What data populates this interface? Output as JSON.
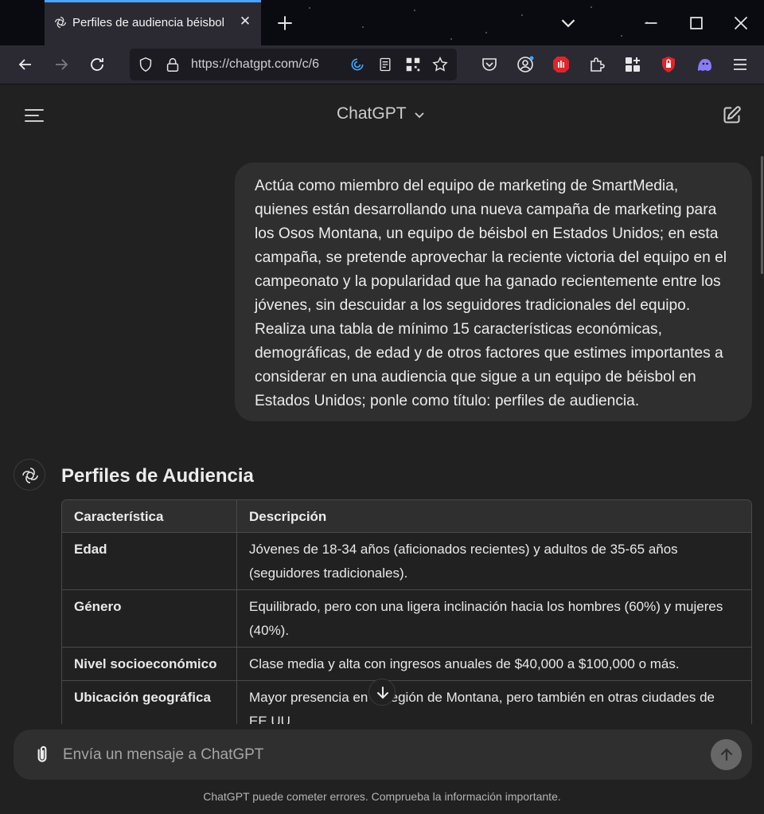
{
  "browser": {
    "tab_title": "Perfiles de audiencia béisbol",
    "url": "https://chatgpt.com/c/6"
  },
  "header": {
    "title": "ChatGPT"
  },
  "conversation": {
    "user_message": "Actúa como miembro del equipo de marketing de SmartMedia, quienes están desarrollando una nueva campaña de marketing para los Osos Montana, un equipo de béisbol en Estados Unidos; en esta campaña, se pretende aprovechar la reciente victoria del equipo en el campeonato y la popularidad que ha ganado recientemente entre los jóvenes, sin descuidar a los seguidores tradicionales del equipo. Realiza una tabla de mínimo 15 características económicas, demográficas, de edad y de otros factores que estimes importantes a considerar en una audiencia que sigue a un equipo de béisbol en Estados Unidos; ponle como título: perfiles de audiencia.",
    "answer_title": "Perfiles de Audiencia",
    "table": {
      "headers": [
        "Característica",
        "Descripción"
      ],
      "rows": [
        [
          "Edad",
          "Jóvenes de 18-34 años (aficionados recientes) y adultos de 35-65 años (seguidores tradicionales)."
        ],
        [
          "Género",
          "Equilibrado, pero con una ligera inclinación hacia los hombres (60%) y mujeres (40%)."
        ],
        [
          "Nivel socioeconómico",
          "Clase media y alta con ingresos anuales de $40,000 a $100,000 o más."
        ],
        [
          "Ubicación geográfica",
          "Mayor presencia en la región de Montana, pero también en otras ciudades de EE.UU."
        ]
      ]
    }
  },
  "composer": {
    "placeholder": "Envía un mensaje a ChatGPT",
    "disclaimer": "ChatGPT puede cometer errores. Comprueba la información importante."
  }
}
